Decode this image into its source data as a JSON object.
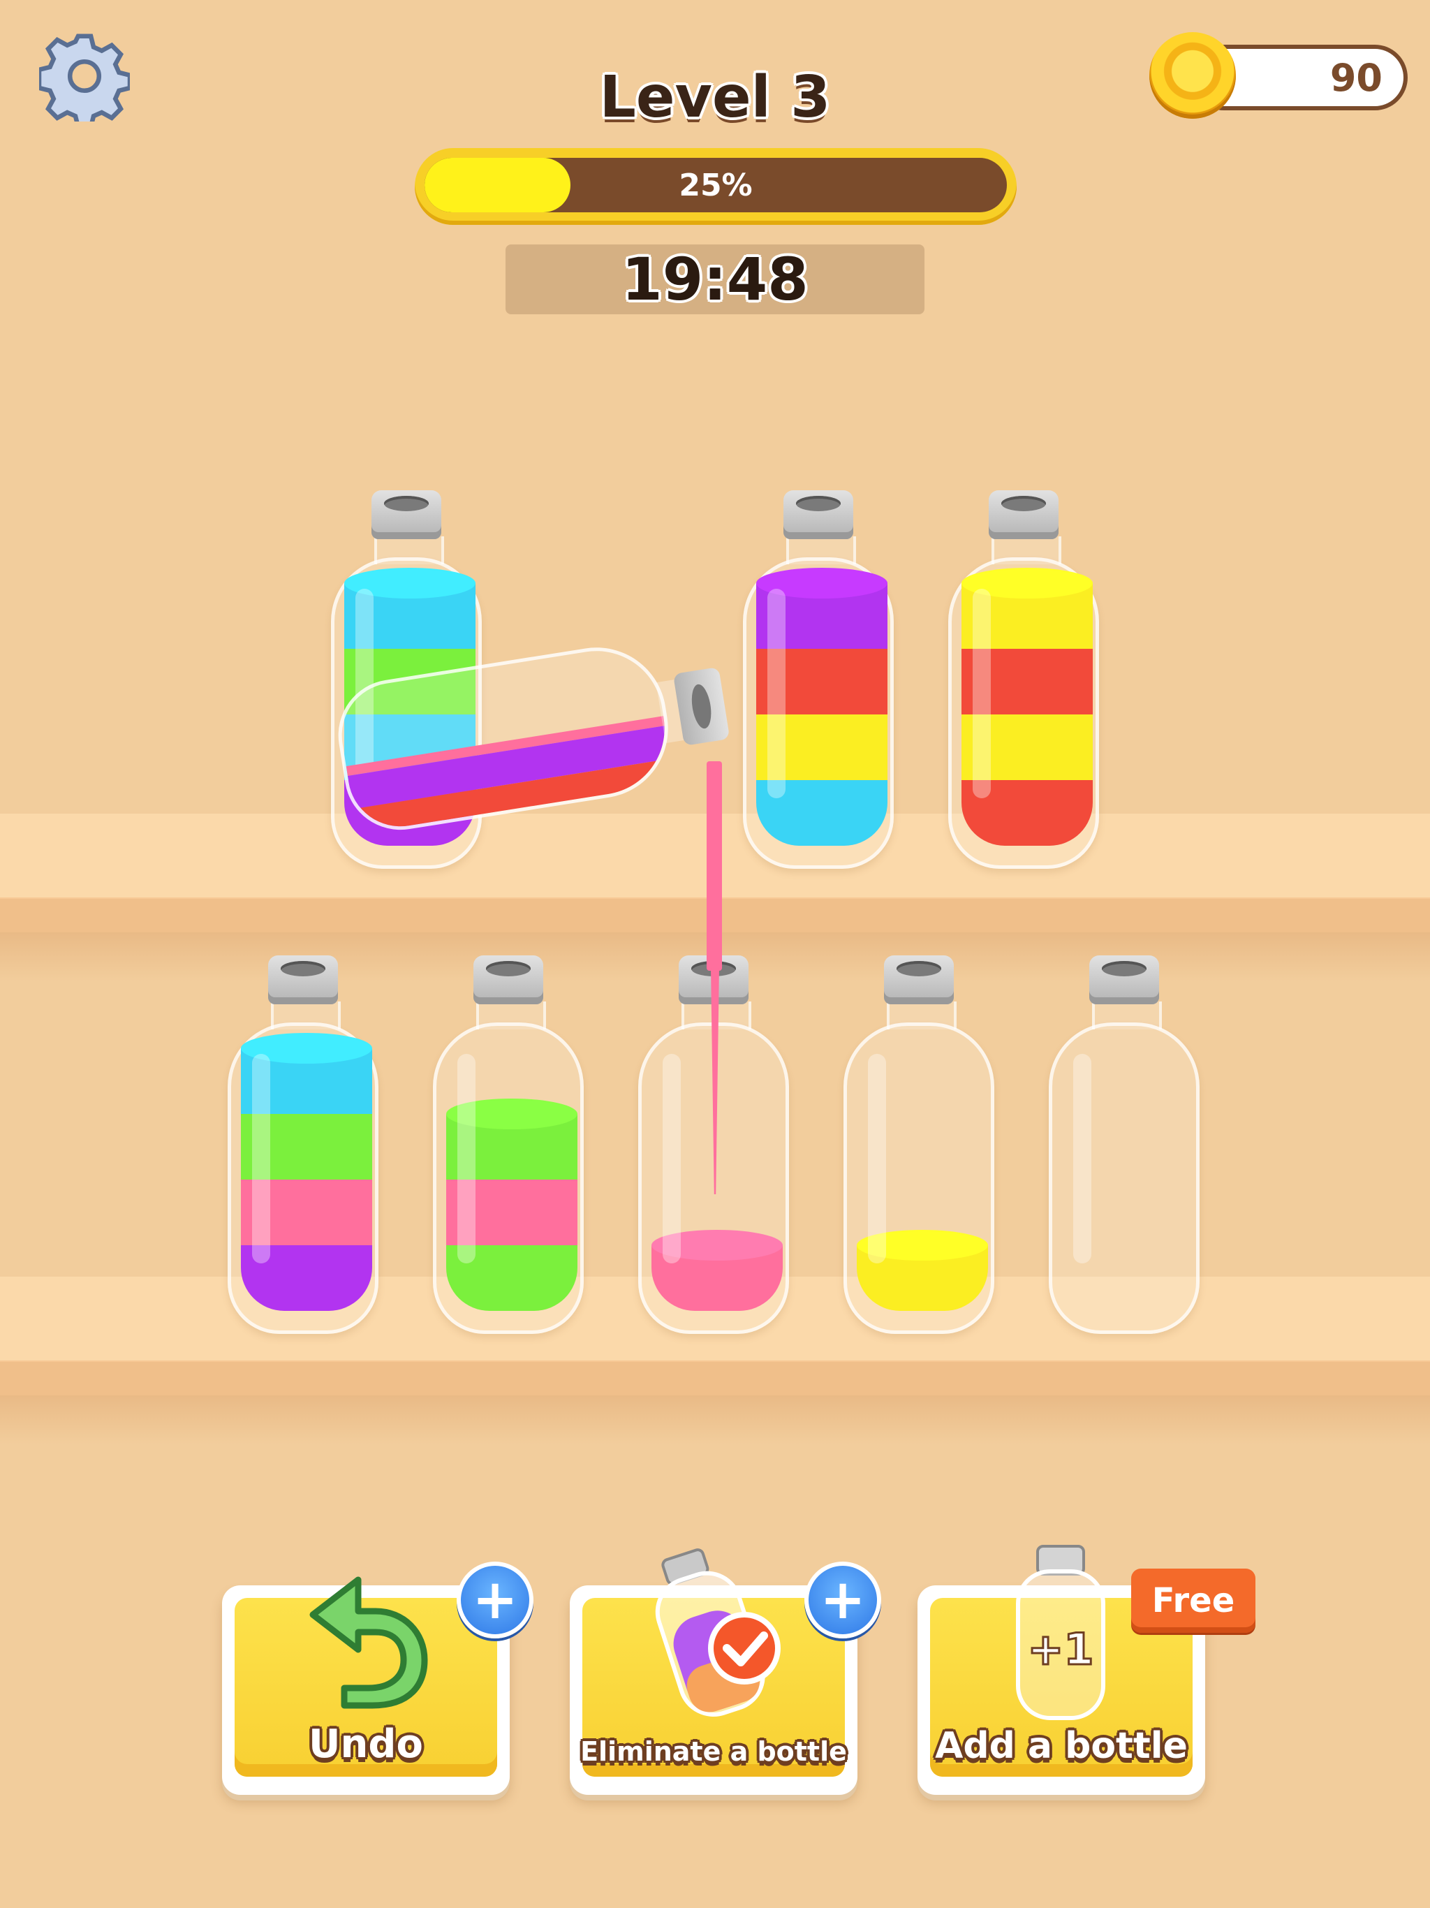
{
  "header": {
    "level_label": "Level 3",
    "progress_percent": 25,
    "progress_label": "25%",
    "timer": "19:48",
    "coins": "90"
  },
  "colors": {
    "cyan": "#3ad4f5",
    "green": "#7bf03d",
    "purple": "#b234f0",
    "red": "#f24a3a",
    "yellow": "#fbee22",
    "pink": "#ff6f9d",
    "background": "#f2cd9c",
    "shelf": "#fbd9aa"
  },
  "bottles": {
    "top_row": [
      {
        "id": "bottle-1",
        "layers_bottom_to_top": [
          "purple",
          "cyan",
          "green",
          "cyan"
        ],
        "state": "pouring"
      },
      {
        "id": "bottle-2",
        "layers_bottom_to_top": [
          "cyan",
          "yellow",
          "red",
          "purple"
        ]
      },
      {
        "id": "bottle-3",
        "layers_bottom_to_top": [
          "red",
          "yellow",
          "red",
          "yellow"
        ]
      }
    ],
    "tilted": {
      "layers": [
        "red",
        "purple",
        "pink"
      ]
    },
    "bottom_row": [
      {
        "id": "bottle-4",
        "layers_bottom_to_top": [
          "purple",
          "pink",
          "green",
          "cyan"
        ]
      },
      {
        "id": "bottle-5",
        "layers_bottom_to_top": [
          "green",
          "pink",
          "green"
        ]
      },
      {
        "id": "bottle-6",
        "layers_bottom_to_top": [
          "pink"
        ],
        "state": "receiving"
      },
      {
        "id": "bottle-7",
        "layers_bottom_to_top": [
          "yellow"
        ]
      },
      {
        "id": "bottle-8",
        "layers_bottom_to_top": []
      }
    ]
  },
  "tools": {
    "undo": {
      "label": "Undo",
      "icon": "undo-arrow-icon",
      "badge": "+"
    },
    "eliminate": {
      "label": "Eliminate a bottle",
      "icon": "bottle-check-icon",
      "badge": "+"
    },
    "add": {
      "label": "Add a bottle",
      "icon": "bottle-plus-one-icon",
      "icon_text": "+1",
      "badge": "Free"
    }
  }
}
